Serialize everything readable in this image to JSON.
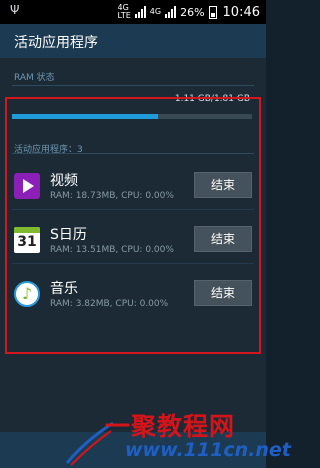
{
  "status_bar": {
    "usb_icon": "usb-icon",
    "network_top": "4G",
    "network_bottom": "LTE",
    "network_alt": "4G",
    "battery_percent": "26%",
    "time": "10:46"
  },
  "header": {
    "title": "活动应用程序"
  },
  "ram": {
    "label": "RAM 状态",
    "usage_text": "1.11 GB/1.81 GB",
    "used_fraction": 0.61,
    "bar_color": "#1e9bd8"
  },
  "apps_section": {
    "label": "活动应用程序：3"
  },
  "apps": [
    {
      "name": "视频",
      "stats": "RAM: 18.73MB, CPU: 0.00%",
      "button": "结束",
      "icon": "video-player-icon"
    },
    {
      "name": "S日历",
      "stats": "RAM: 13.51MB, CPU: 0.00%",
      "button": "结束",
      "icon": "calendar-icon",
      "icon_text": "31"
    },
    {
      "name": "音乐",
      "stats": "RAM: 3.82MB, CPU: 0.00%",
      "button": "结束",
      "icon": "music-icon"
    }
  ],
  "watermark": {
    "top": "一聚教程网",
    "bottom": "www.111cn.net"
  },
  "colors": {
    "highlight": "#d4161f",
    "header": "#1c3b52",
    "background": "#1b2a35"
  }
}
